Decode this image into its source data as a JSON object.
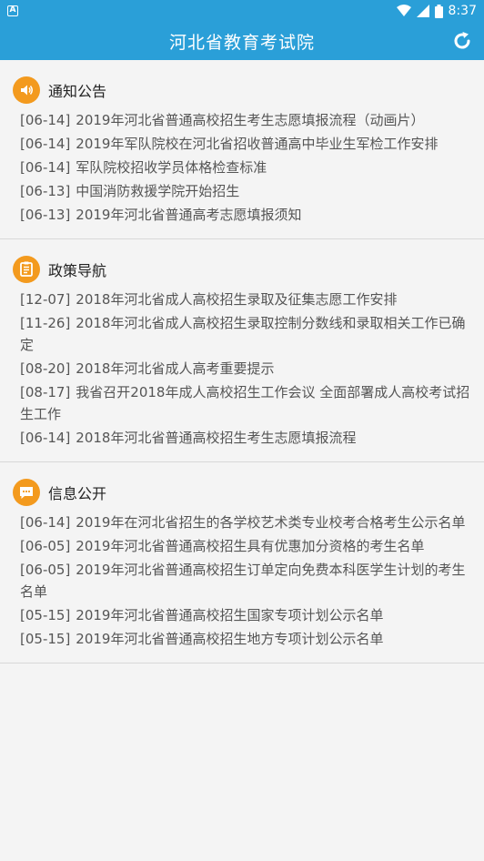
{
  "status_bar": {
    "app_badge": "A",
    "time": "8:37"
  },
  "header": {
    "title": "河北省教育考试院"
  },
  "sections": [
    {
      "title": "通知公告",
      "icon": "speaker-icon",
      "items": [
        {
          "date": "[06-14]",
          "text": "2019年河北省普通高校招生考生志愿填报流程（动画片）"
        },
        {
          "date": "[06-14]",
          "text": "2019年军队院校在河北省招收普通高中毕业生军检工作安排"
        },
        {
          "date": "[06-14]",
          "text": "军队院校招收学员体格检查标准"
        },
        {
          "date": "[06-13]",
          "text": "中国消防救援学院开始招生"
        },
        {
          "date": "[06-13]",
          "text": "2019年河北省普通高考志愿填报须知"
        }
      ]
    },
    {
      "title": "政策导航",
      "icon": "document-icon",
      "items": [
        {
          "date": "[12-07]",
          "text": "2018年河北省成人高校招生录取及征集志愿工作安排"
        },
        {
          "date": "[11-26]",
          "text": "2018年河北省成人高校招生录取控制分数线和录取相关工作已确定"
        },
        {
          "date": "[08-20]",
          "text": "2018年河北省成人高考重要提示"
        },
        {
          "date": "[08-17]",
          "text": "我省召开2018年成人高校招生工作会议  全面部署成人高校考试招生工作"
        },
        {
          "date": "[06-14]",
          "text": "2018年河北省普通高校招生考生志愿填报流程"
        }
      ]
    },
    {
      "title": "信息公开",
      "icon": "message-icon",
      "items": [
        {
          "date": "[06-14]",
          "text": "2019年在河北省招生的各学校艺术类专业校考合格考生公示名单"
        },
        {
          "date": "[06-05]",
          "text": "2019年河北省普通高校招生具有优惠加分资格的考生名单"
        },
        {
          "date": "[06-05]",
          "text": "2019年河北省普通高校招生订单定向免费本科医学生计划的考生名单"
        },
        {
          "date": "[05-15]",
          "text": "2019年河北省普通高校招生国家专项计划公示名单"
        },
        {
          "date": "[05-15]",
          "text": "2019年河北省普通高校招生地方专项计划公示名单"
        }
      ]
    }
  ]
}
